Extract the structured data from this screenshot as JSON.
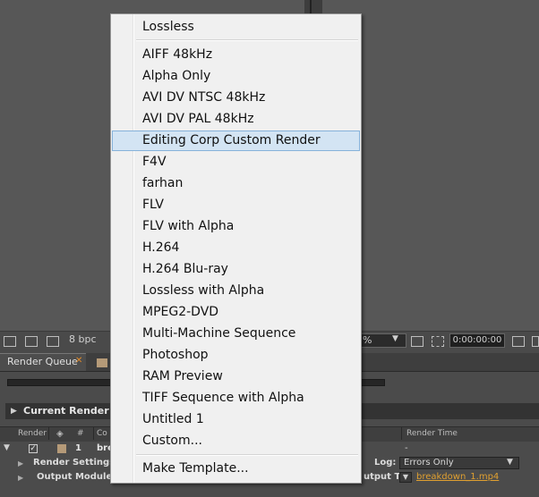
{
  "viewer": {
    "bpc": "8 bpc",
    "zoom": "%",
    "timecode": "0:00:00:00"
  },
  "render_queue": {
    "tab_label": "Render Queue",
    "current_render": "Current Render",
    "columns": {
      "render": "Render",
      "num": "#",
      "comp": "Co",
      "render_time": "Render Time"
    },
    "row": {
      "num": "1",
      "comp_name": "bre",
      "render_time": "-",
      "render_settings_label": "Render Settings:",
      "output_module_label": "Output Module:",
      "log_label": "Log:",
      "log_value": "Errors Only",
      "output_to_label": "utput To:",
      "output_file": "breakdown_1.mp4"
    }
  },
  "menu": {
    "header": "Lossless",
    "items": [
      "AIFF 48kHz",
      "Alpha Only",
      "AVI DV NTSC 48kHz",
      "AVI DV PAL 48kHz",
      "Editing Corp Custom Render",
      "F4V",
      "farhan",
      "FLV",
      "FLV with Alpha",
      "H.264",
      "H.264 Blu-ray",
      "Lossless with Alpha",
      "MPEG2-DVD",
      "Multi-Machine Sequence",
      "Photoshop",
      "RAM Preview",
      "TIFF Sequence with Alpha",
      "Untitled 1",
      "Custom..."
    ],
    "highlighted": "Editing Corp Custom Render",
    "footer": "Make Template..."
  }
}
